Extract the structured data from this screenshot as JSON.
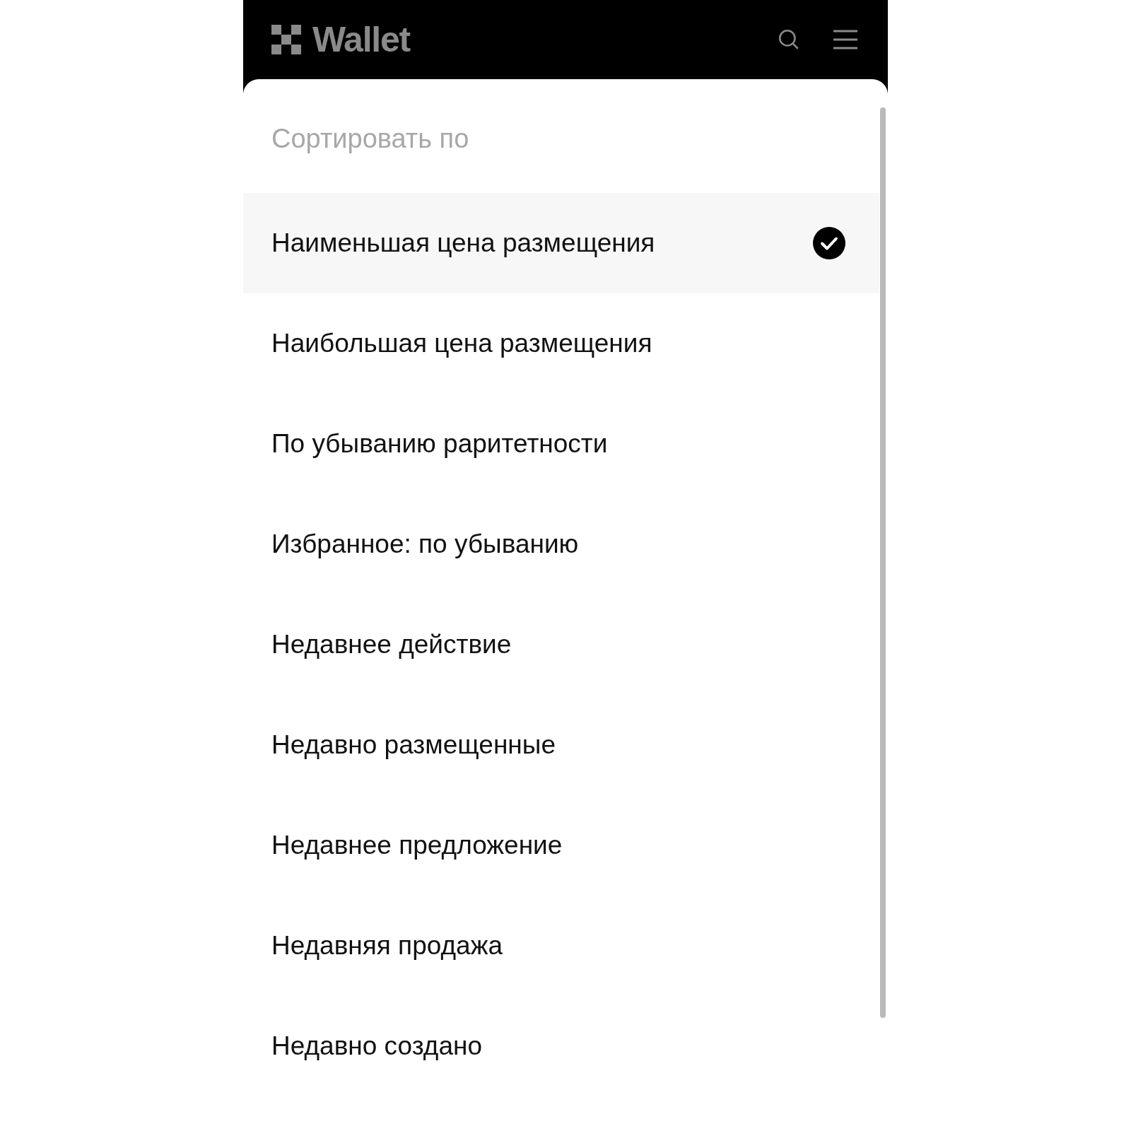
{
  "header": {
    "brand": "Wallet"
  },
  "sheet": {
    "title": "Сортировать по",
    "options": [
      {
        "label": "Наименьшая цена размещения",
        "selected": true
      },
      {
        "label": "Наибольшая цена размещения",
        "selected": false
      },
      {
        "label": "По убыванию раритетности",
        "selected": false
      },
      {
        "label": "Избранное: по убыванию",
        "selected": false
      },
      {
        "label": "Недавнее действие",
        "selected": false
      },
      {
        "label": "Недавно размещенные",
        "selected": false
      },
      {
        "label": "Недавнее предложение",
        "selected": false
      },
      {
        "label": "Недавняя продажа",
        "selected": false
      },
      {
        "label": "Недавно создано",
        "selected": false
      }
    ]
  }
}
